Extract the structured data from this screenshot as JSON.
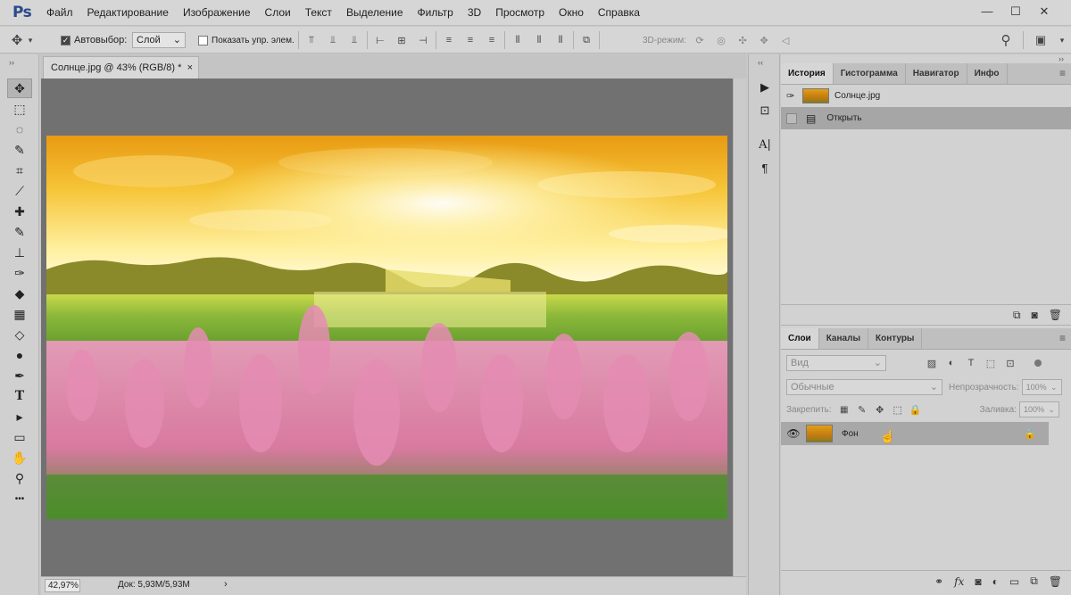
{
  "app": {
    "logo": "Ps"
  },
  "menu": [
    "Файл",
    "Редактирование",
    "Изображение",
    "Слои",
    "Текст",
    "Выделение",
    "Фильтр",
    "3D",
    "Просмотр",
    "Окно",
    "Справка"
  ],
  "window_buttons": [
    "—",
    "☐",
    "✕"
  ],
  "options": {
    "autoselect_label": "Автовыбор:",
    "autoselect_value": "Слой",
    "show_controls_label": "Показать упр. элем.",
    "mode3d_label": "3D-режим:"
  },
  "document": {
    "tab_title": "Солнце.jpg @ 43% (RGB/8) *",
    "close": "×",
    "zoom": "42,97%",
    "doc_info": "Док: 5,93M/5,93M",
    "status_arrow": "›"
  },
  "history_panel": {
    "tabs": [
      "История",
      "Гистограмма",
      "Навигатор",
      "Инфо"
    ],
    "snapshot_name": "Солнце.jpg",
    "entries": [
      "Открыть"
    ]
  },
  "layers_panel": {
    "tabs": [
      "Слои",
      "Каналы",
      "Контуры"
    ],
    "filter_placeholder": "Вид",
    "blend_mode": "Обычные",
    "opacity_label": "Непрозрачность:",
    "opacity_value": "100%",
    "lock_label": "Закрепить:",
    "fill_label": "Заливка:",
    "fill_value": "100%",
    "layer_name": "Фон"
  },
  "icons": {
    "move": "✥",
    "marquee": "⬚",
    "lasso": "◌",
    "quick-select": "✎",
    "crop": "⌗",
    "eyedropper": "⟋",
    "heal": "✚",
    "brush": "✎",
    "stamp": "⊥",
    "history-brush": "✑",
    "eraser": "◆",
    "gradient": "▦",
    "blur": "◇",
    "dodge": "●",
    "pen": "✒",
    "type": "T",
    "path-select": "▸",
    "shape": "▭",
    "hand": "✋",
    "zoom": "⚲",
    "more": "•••"
  }
}
